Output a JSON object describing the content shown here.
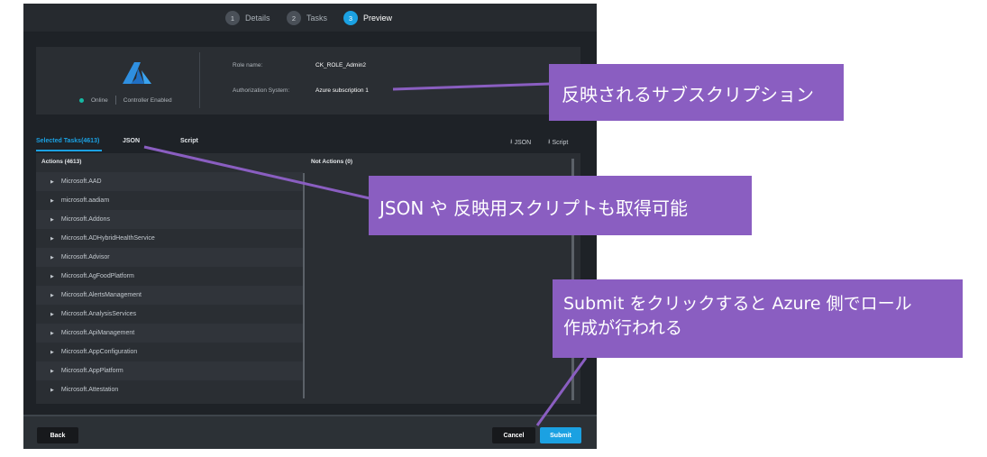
{
  "steps": [
    {
      "number": "1",
      "label": "Details"
    },
    {
      "number": "2",
      "label": "Tasks"
    },
    {
      "number": "3",
      "label": "Preview"
    }
  ],
  "info": {
    "status_online": "Online",
    "status_controller": "Controller Enabled",
    "role_name_label": "Role name:",
    "role_name_value": "CK_ROLE_Admin2",
    "auth_system_label": "Authorization System:",
    "auth_system_value": "Azure subscription 1"
  },
  "tabs": [
    {
      "label": "Selected Tasks(4613)",
      "active": true
    },
    {
      "label": "JSON",
      "active": false
    },
    {
      "label": "Script",
      "active": false
    }
  ],
  "downloads": {
    "json_label": "JSON",
    "script_label": "Script"
  },
  "panel": {
    "actions_header": "Actions (4613)",
    "not_actions_header": "Not Actions (0)",
    "actions": [
      "Microsoft.AAD",
      "microsoft.aadiam",
      "Microsoft.Addons",
      "Microsoft.ADHybridHealthService",
      "Microsoft.Advisor",
      "Microsoft.AgFoodPlatform",
      "Microsoft.AlertsManagement",
      "Microsoft.AnalysisServices",
      "Microsoft.ApiManagement",
      "Microsoft.AppConfiguration",
      "Microsoft.AppPlatform",
      "Microsoft.Attestation"
    ]
  },
  "footer": {
    "back_label": "Back",
    "cancel_label": "Cancel",
    "submit_label": "Submit"
  },
  "callouts": {
    "subscription": "反映されるサブスクリプション",
    "json_script": "JSON や 反映用スクリプトも取得可能",
    "submit_line1": "Submit をクリックすると Azure 側でロール",
    "submit_line2": "作成が行われる"
  },
  "colors": {
    "accent": "#1ba1e2",
    "online": "#16b8a3",
    "callout": "#8a5ec1"
  }
}
